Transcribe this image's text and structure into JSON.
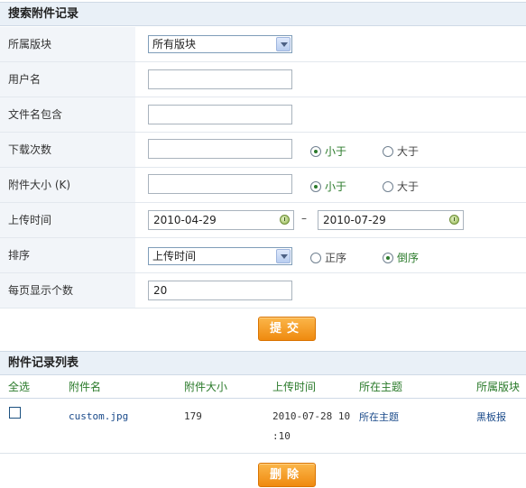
{
  "search_section": {
    "title": "搜索附件记录"
  },
  "form": {
    "forum": {
      "label": "所属版块",
      "selected": "所有版块"
    },
    "username": {
      "label": "用户名",
      "value": ""
    },
    "filename": {
      "label": "文件名包含",
      "value": ""
    },
    "downloads": {
      "label": "下载次数",
      "value": "",
      "less_label": "小于",
      "greater_label": "大于",
      "selected": "less"
    },
    "size": {
      "label": "附件大小 (K)",
      "value": "",
      "less_label": "小于",
      "greater_label": "大于",
      "selected": "less"
    },
    "upload_time": {
      "label": "上传时间",
      "from": "2010-04-29",
      "separator": "–",
      "to": "2010-07-29"
    },
    "sort": {
      "label": "排序",
      "selected": "上传时间",
      "asc_label": "正序",
      "desc_label": "倒序",
      "order": "desc"
    },
    "per_page": {
      "label": "每页显示个数",
      "value": "20"
    },
    "submit_label": "提交"
  },
  "list_section": {
    "title": "附件记录列表",
    "columns": [
      "全选",
      "附件名",
      "附件大小",
      "上传时间",
      "所在主题",
      "所属版块"
    ],
    "rows": [
      {
        "checked": false,
        "filename": "custom.jpg",
        "size": "179",
        "time_line1": "2010-07-28 10",
        "time_line2": ":10",
        "topic": "所在主题",
        "forum": "黑板报"
      }
    ],
    "delete_label": "删除"
  }
}
